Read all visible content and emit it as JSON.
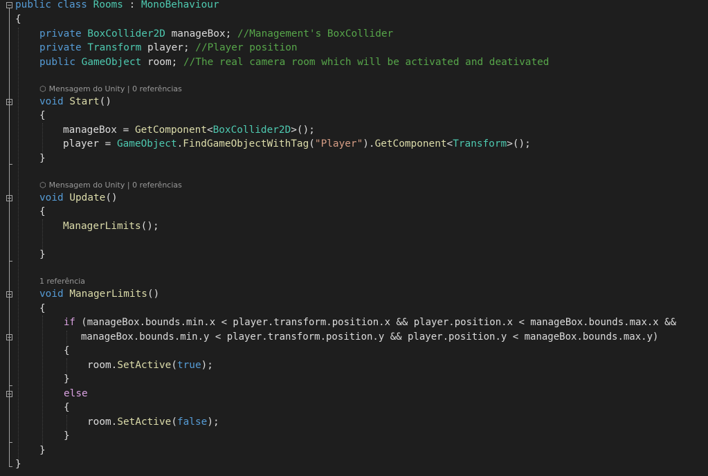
{
  "editor": {
    "colors": {
      "background": "#1e1e1e",
      "keyword": "#569cd6",
      "control": "#d8a0df",
      "type": "#4ec9b0",
      "method": "#dcdcaa",
      "string": "#d69d85",
      "comment": "#57a64a",
      "text": "#dcdcdc",
      "codelens": "#999999"
    },
    "lines": {
      "class_decl": {
        "kw1": "public",
        "kw2": "class",
        "name": "Rooms",
        "colon": " : ",
        "base": "MonoBehaviour"
      },
      "open_brace": "{",
      "close_brace": "}",
      "field1": {
        "kw": "private",
        "type": "BoxCollider2D",
        "rest": " manageBox; ",
        "comment": "//Management's BoxCollider"
      },
      "field2": {
        "kw": "private",
        "type": "Transform",
        "rest": " player; ",
        "comment": "//Player position"
      },
      "field3": {
        "kw": "public",
        "type": "GameObject",
        "rest": " room; ",
        "comment": "//The real camera room which will be activated and deativated"
      },
      "lens_start": {
        "icon": "unity-icon",
        "message": "Mensagem do Unity",
        "sep": " | ",
        "refs": "0 referências"
      },
      "start_sig": {
        "kw": "void",
        "name": "Start",
        "parens": "()"
      },
      "start_l1": {
        "a": "manageBox = ",
        "method": "GetComponent",
        "lt": "<",
        "type": "BoxCollider2D",
        "tail": ">();"
      },
      "start_l2": {
        "a": "player = ",
        "type1": "GameObject",
        "dot": ".",
        "method": "FindGameObjectWithTag",
        "open": "(",
        "str": "\"Player\"",
        "mid": ").",
        "method2": "GetComponent",
        "lt": "<",
        "type2": "Transform",
        "tail": ">();"
      },
      "lens_update": {
        "icon": "unity-icon",
        "message": "Mensagem do Unity",
        "sep": " | ",
        "refs": "0 referências"
      },
      "update_sig": {
        "kw": "void",
        "name": "Update",
        "parens": "()"
      },
      "update_l1": {
        "method": "ManagerLimits",
        "tail": "();"
      },
      "lens_limits": {
        "refs": "1 referência"
      },
      "limits_sig": {
        "kw": "void",
        "name": "ManagerLimits",
        "parens": "()"
      },
      "if_l1": {
        "kw": "if",
        "text": " (manageBox.bounds.min.x < player.transform.position.x && player.position.x < manageBox.bounds.max.x &&"
      },
      "if_l2": "manageBox.bounds.min.y < player.transform.position.y && player.position.y < manageBox.bounds.max.y)",
      "set_true": {
        "a": "room.",
        "method": "SetActive",
        "open": "(",
        "val": "true",
        "tail": ");"
      },
      "else": "else",
      "set_false": {
        "a": "room.",
        "method": "SetActive",
        "open": "(",
        "val": "false",
        "tail": ");"
      }
    }
  }
}
